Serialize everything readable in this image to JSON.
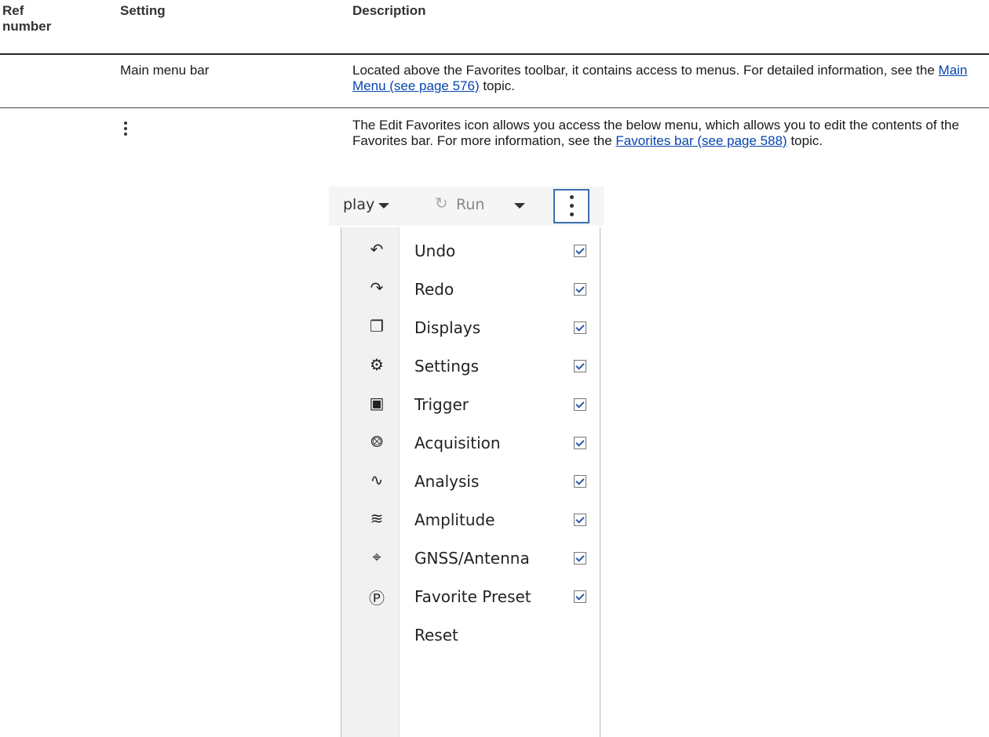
{
  "table": {
    "headers": {
      "ref": "Ref number",
      "setting": "Setting",
      "description": "Description"
    },
    "row1": {
      "setting": "Main menu bar",
      "desc_before": "Located above the Favorites toolbar, it contains access to menus. For detailed information, see the ",
      "link": "Main Menu (see page 576)",
      "desc_after": " topic."
    },
    "row2": {
      "icon": "vertical-ellipsis-icon",
      "desc_before": "The Edit Favorites icon allows you access the below menu, which allows you to edit the contents of the Favorites bar. For more information, see the ",
      "link": "Favorites bar (see page 588)",
      "desc_after": " topic."
    }
  },
  "menu_screenshot": {
    "toolbar": {
      "display_partial": "play",
      "run": "Run",
      "run_icon": "refresh-icon",
      "button_icon": "vertical-ellipsis-icon"
    },
    "items": [
      {
        "label": "Undo",
        "icon": "undo-icon",
        "checked": true
      },
      {
        "label": "Redo",
        "icon": "redo-icon",
        "checked": true
      },
      {
        "label": "Displays",
        "icon": "displays-icon",
        "checked": true
      },
      {
        "label": "Settings",
        "icon": "gear-icon",
        "checked": true
      },
      {
        "label": "Trigger",
        "icon": "trigger-icon",
        "checked": true
      },
      {
        "label": "Acquisition",
        "icon": "acquisition-icon",
        "checked": true
      },
      {
        "label": "Analysis",
        "icon": "analysis-icon",
        "checked": true
      },
      {
        "label": "Amplitude",
        "icon": "amplitude-icon",
        "checked": true
      },
      {
        "label": "GNSS/Antenna",
        "icon": "antenna-icon",
        "checked": true
      },
      {
        "label": "Favorite Preset",
        "icon": "preset-icon",
        "checked": true
      },
      {
        "label": "Reset"
      }
    ]
  }
}
